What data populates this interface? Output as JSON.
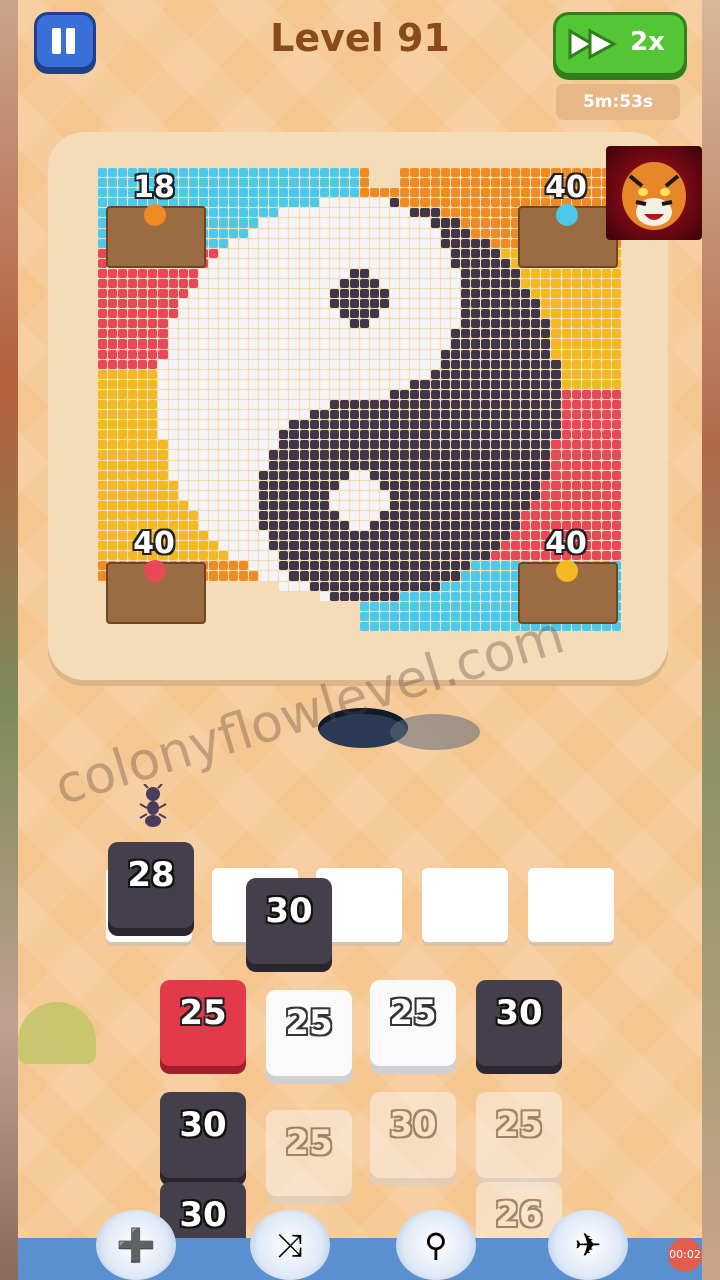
{
  "header": {
    "level_title": "Level 91",
    "speed_label": "2x",
    "timer": "5m:53s"
  },
  "pixel_art": {
    "grid_cols": 52,
    "grid_rows": 46,
    "colors": {
      "white": "#f4f4f6",
      "dark": "#3f3748",
      "red": "#e8485a",
      "orange": "#f08a23",
      "cyan": "#4cc9ea",
      "yellow": "#f3b922"
    }
  },
  "pigs": [
    {
      "id": "orange",
      "count": "18",
      "color": "#f08a23"
    },
    {
      "id": "cyan",
      "count": "40",
      "color": "#4cc9ea"
    },
    {
      "id": "red",
      "count": "40",
      "color": "#e8485a"
    },
    {
      "id": "yellow",
      "count": "40",
      "color": "#f3b922"
    }
  ],
  "watermark": "colonyflowlevel.com",
  "queue": {
    "active": "28",
    "floating": "30"
  },
  "tray": [
    {
      "value": "25",
      "style": "red"
    },
    {
      "value": "25",
      "style": "white"
    },
    {
      "value": "25",
      "style": "white"
    },
    {
      "value": "30",
      "style": "dark"
    },
    {
      "value": "30",
      "style": "dark"
    },
    {
      "value": "25",
      "style": "white"
    },
    {
      "value": "30",
      "style": "white"
    },
    {
      "value": "25",
      "style": "white"
    },
    {
      "value": "30",
      "style": "dark"
    },
    {
      "value": "26",
      "style": "white"
    }
  ],
  "tools": [
    "add-slot-icon",
    "shuffle-icon",
    "magnet-claw-icon",
    "vacuum-icon"
  ],
  "recording_time": "00:02"
}
